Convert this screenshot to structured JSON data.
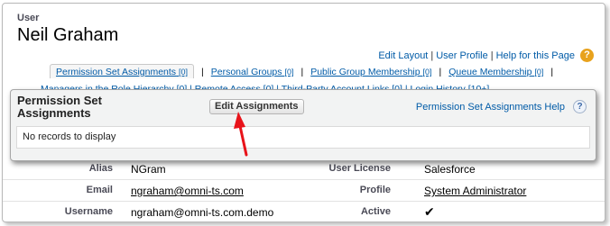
{
  "header": {
    "object_type": "User",
    "name": "Neil Graham"
  },
  "help_links": {
    "edit_layout": "Edit Layout",
    "user_profile": "User Profile",
    "help": "Help for this Page",
    "separator": "|",
    "help_icon_glyph": "?"
  },
  "related_lists_row1": [
    {
      "label": "Permission Set Assignments",
      "count": "[0]"
    },
    {
      "label": "Personal Groups",
      "count": "[0]"
    },
    {
      "label": "Public Group Membership",
      "count": "[0]"
    },
    {
      "label": "Queue Membership",
      "count": "[0]"
    }
  ],
  "related_lists_row2_partial": "Managers in the Role Hierarchy [0]  |  Remote Access [0]  |  Third-Party Account Links [0]  |  Login History [10+]",
  "popup": {
    "title": "Permission Set Assignments",
    "edit_button": "Edit Assignments",
    "help_link": "Permission Set Assignments Help",
    "help_glyph": "?",
    "empty_message": "No records to display"
  },
  "details": [
    {
      "left_label": "Alias",
      "left_value": "NGram",
      "right_label": "User License",
      "right_value": "Salesforce"
    },
    {
      "left_label": "Email",
      "left_value": "ngraham@omni-ts.com",
      "right_label": "Profile",
      "right_value": "System Administrator"
    },
    {
      "left_label": "Username",
      "left_value": "ngraham@omni-ts.com.demo",
      "right_label": "Active",
      "right_value": "✔"
    }
  ],
  "colors": {
    "link": "#015ba7",
    "label": "#4a4a56",
    "help_icon": "#e8a21d",
    "arrow": "#e8131a"
  }
}
